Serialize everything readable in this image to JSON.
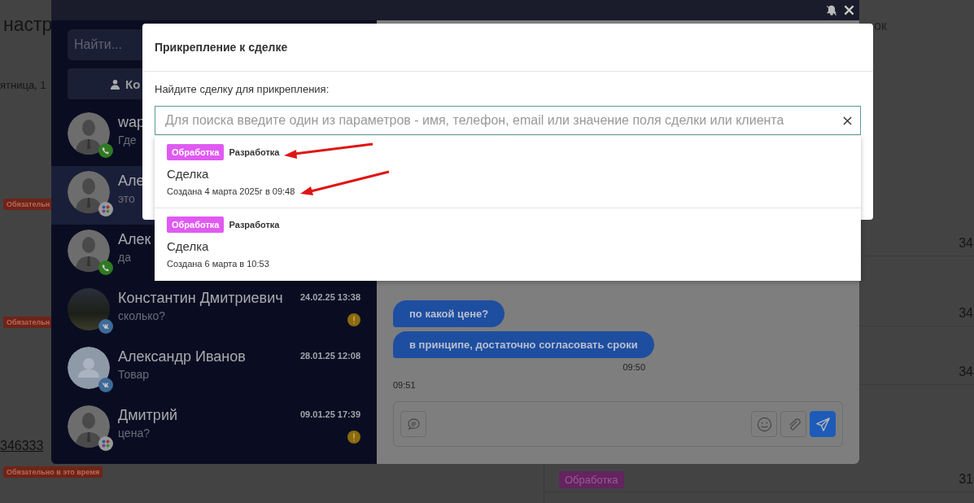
{
  "background_page": {
    "heading": "настр",
    "top_right": "ок",
    "day": "ятница, 1",
    "left_tags": [
      {
        "text": "Обязательн"
      },
      {
        "text": "Обязательн"
      }
    ],
    "phone": "346333",
    "phone_tag": "Обязательно в это время",
    "right_numbers": [
      "34",
      "34",
      "34",
      "31"
    ],
    "right_tag": "Обработка"
  },
  "chat_window": {
    "search": {
      "placeholder": "Найти..."
    },
    "contacts_button": "Ко",
    "chats": [
      {
        "name": "wap",
        "message": "Где",
        "avatar": {
          "kind": "silhouette"
        },
        "channel": {
          "kind": "phone"
        },
        "warning": false,
        "selected": false
      },
      {
        "name": "Але",
        "message": "это",
        "avatar": {
          "kind": "silhouette"
        },
        "channel": {
          "kind": "multi"
        },
        "warning": false,
        "selected": true
      },
      {
        "name": "Алек",
        "message": "да",
        "avatar": {
          "kind": "silhouette"
        },
        "channel": {
          "kind": "phone"
        },
        "warning": false,
        "selected": false
      },
      {
        "name": "Константин Дмитриевич",
        "message": "сколько?",
        "time": "24.02.25 13:38",
        "avatar": {
          "kind": "photo"
        },
        "channel": {
          "kind": "vk"
        },
        "warning": true,
        "selected": false
      },
      {
        "name": "Александр Иванов",
        "message": "Товар",
        "time": "28.01.25 12:08",
        "avatar": {
          "kind": "default"
        },
        "channel": {
          "kind": "vk"
        },
        "warning": false,
        "selected": false
      },
      {
        "name": "Дмитрий",
        "message": "цена?",
        "time": "09.01.25 17:39",
        "avatar": {
          "kind": "silhouette"
        },
        "channel": {
          "kind": "multi"
        },
        "warning": true,
        "selected": false
      }
    ],
    "messages": [
      {
        "kind": "bubble",
        "text": "по какой цене?"
      },
      {
        "kind": "bubble",
        "text": "в принципе, достаточно согласовать сроки"
      },
      {
        "kind": "time_right",
        "text": "09:50"
      },
      {
        "kind": "time_left",
        "text": "09:51"
      }
    ]
  },
  "modal": {
    "title": "Прикрепление к сделке",
    "label": "Найдите сделку для прикрепления:",
    "search": {
      "placeholder": "Для поиска введите один из параметров - имя, телефон, email или значение поля сделки или клиента"
    },
    "results": [
      {
        "status": "Обработка",
        "pipeline": "Разработка",
        "name": "Сделка",
        "created": "Создана 4 марта 2025г в 09:48"
      },
      {
        "status": "Обработка",
        "pipeline": "Разработка",
        "name": "Сделка",
        "created": "Создана 6 марта в 10:53"
      }
    ]
  }
}
